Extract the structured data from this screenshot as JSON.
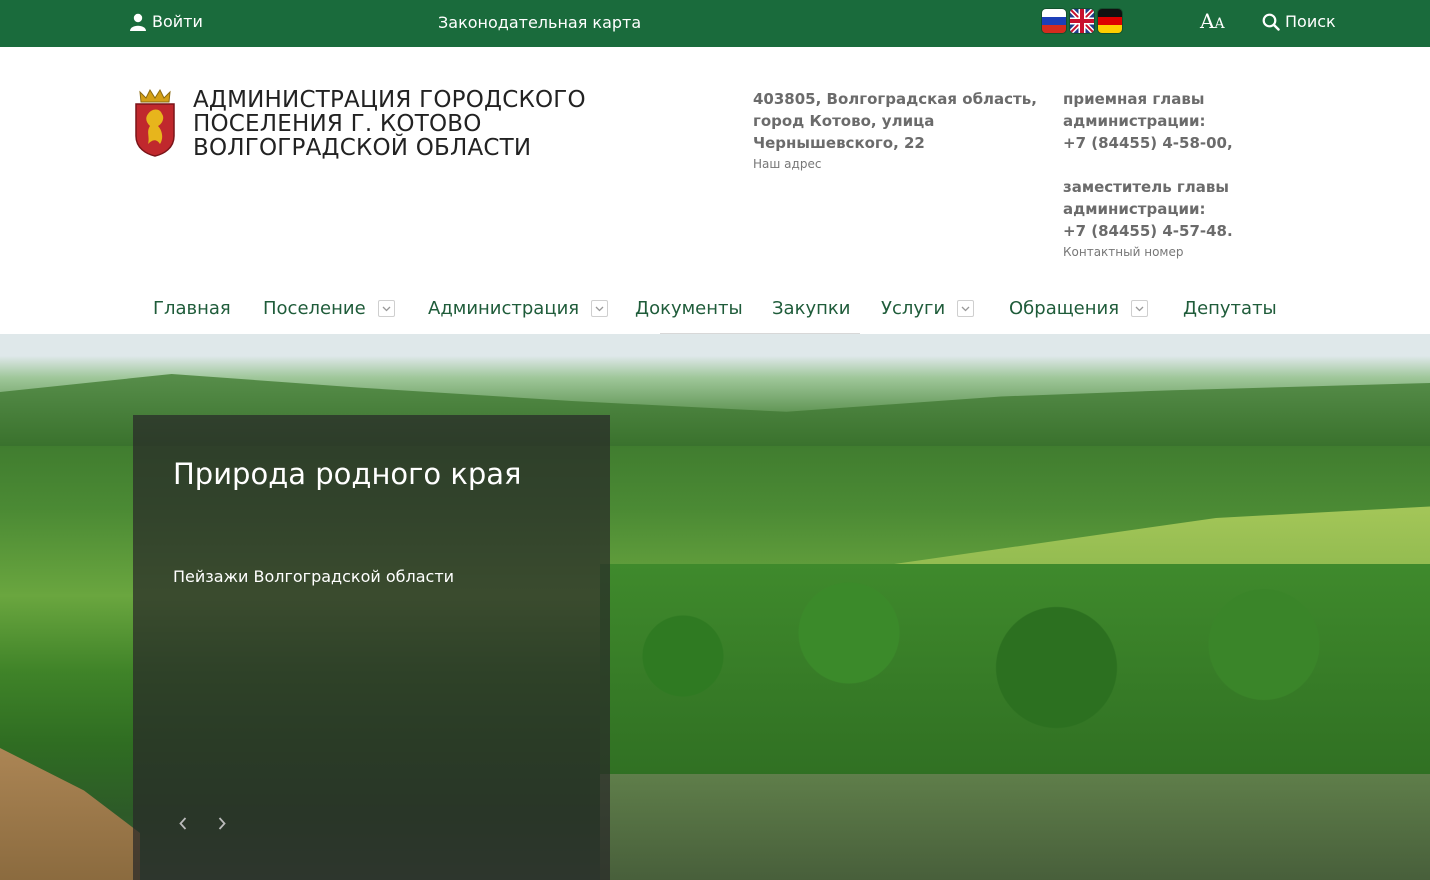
{
  "topbar": {
    "login_label": "Войти",
    "legal_map_label": "Законодательная карта",
    "languages": [
      "ru-flag-icon",
      "gb-flag-icon",
      "de-flag-icon"
    ],
    "font_size_big": "A",
    "font_size_small": "A",
    "search_label": "Поиск",
    "background_color": "#1a6b3c"
  },
  "header": {
    "title_lines": [
      "АДМИНИСТРАЦИЯ ГОРОДСКОГО",
      "ПОСЕЛЕНИЯ Г. КОТОВО",
      "ВОЛГОГРАДСКОЙ ОБЛАСТИ"
    ],
    "address_lines": [
      "403805, Волгоградская область,",
      "город Котово, улица",
      "Чернышевского, 22"
    ],
    "address_caption": "Наш адрес",
    "contact_lines_1": [
      "приемная главы",
      "администрации:",
      "+7 (84455) 4-58-00,"
    ],
    "contact_lines_2": [
      "заместитель главы",
      "администрации:",
      "+7 (84455) 4-57-48."
    ],
    "contact_caption": "Контактный номер"
  },
  "nav": {
    "items": [
      {
        "label": "Главная"
      },
      {
        "label": "Поселение"
      },
      {
        "label": "Администрация"
      },
      {
        "label": "Документы"
      },
      {
        "label": "Закупки"
      },
      {
        "label": "Услуги"
      },
      {
        "label": "Обращения"
      },
      {
        "label": "Депутаты"
      }
    ],
    "link_color": "#1f5c3a"
  },
  "hero": {
    "slide_title": "Природа родного края",
    "slide_subtitle": "Пейзажи Волгоградской области"
  }
}
